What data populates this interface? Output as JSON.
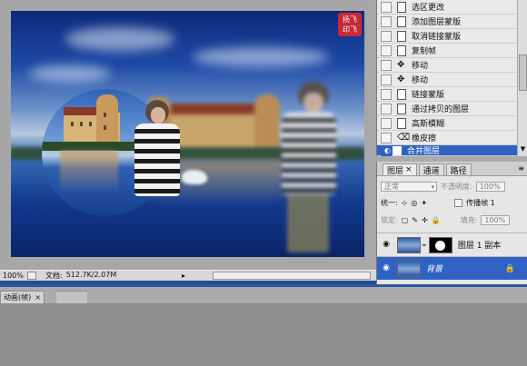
{
  "document": {
    "stamp_line1": "扬飞",
    "stamp_line2": "印飞"
  },
  "statusbar": {
    "zoom": "100%",
    "doc_label": "文档:",
    "doc_size": "512.7K/2.07M"
  },
  "animation_panel": {
    "tab_label": "动画(帧)"
  },
  "history": {
    "items": [
      {
        "label": "选区更改",
        "active": false
      },
      {
        "label": "添加图层蒙版",
        "active": false
      },
      {
        "label": "取消链接蒙版",
        "active": false
      },
      {
        "label": "复制帧",
        "active": false
      },
      {
        "label": "移动",
        "active": false
      },
      {
        "label": "移动",
        "active": false
      },
      {
        "label": "链接蒙版",
        "active": false
      },
      {
        "label": "通过拷贝的图层",
        "active": false
      },
      {
        "label": "高斯模糊",
        "active": false
      },
      {
        "label": "橡皮擦",
        "active": false
      },
      {
        "label": "合并图层",
        "active": true
      }
    ]
  },
  "layers_panel": {
    "tabs": [
      "图层",
      "通道",
      "路径"
    ],
    "active_tab": "图层",
    "blend_mode": "正常",
    "opacity_label": "不透明度:",
    "opacity_value": "100%",
    "unify_label": "统一:",
    "propagate_label": "传播帧 1",
    "lock_label": "锁定:",
    "fill_label": "填充:",
    "fill_value": "100%",
    "layers": [
      {
        "name": "图层 1 副本",
        "visible": true,
        "has_mask": true,
        "active": false
      },
      {
        "name": "背景",
        "visible": true,
        "has_mask": false,
        "active": true
      }
    ]
  },
  "colors": {
    "selection": "#2f62c4",
    "workspace": "#ababab",
    "stamp": "#c8283a"
  }
}
